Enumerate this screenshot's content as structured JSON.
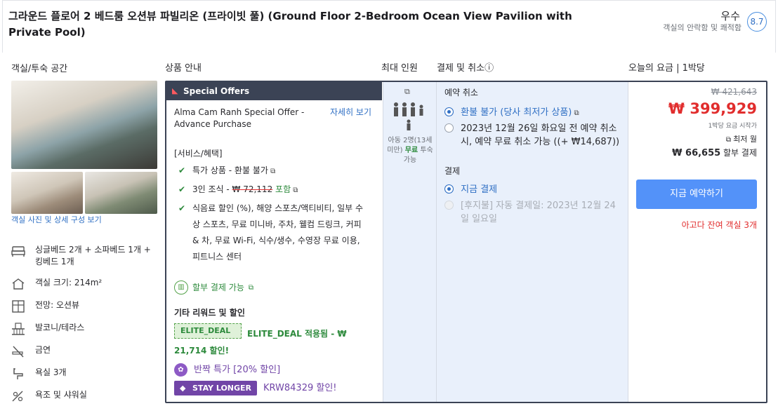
{
  "header": {
    "title": "그라운드 플로어 2 베드룸 오션뷰 파빌리온 (프라이빗 풀) (Ground Floor 2-Bedroom Ocean View Pavilion with Private Pool)",
    "rating_word": "우수",
    "rating_sub": "객실의 안락함 및 쾌적함",
    "rating_score": "8.7"
  },
  "columns": {
    "room": "객실/투숙 공간",
    "product": "상품 안내",
    "max_guests": "최대 인원",
    "payment": "결제 및 취소ⓘ",
    "price": "오늘의 요금 | 1박당"
  },
  "room": {
    "photo_link": "객실 사진 및 상세 구성 보기",
    "features": [
      {
        "icon": "bed-icon",
        "text": "싱글베드 2개 + 소파베드 1개 + 킹베드 1개"
      },
      {
        "icon": "house-icon",
        "text": "객실 크기: 214m²"
      },
      {
        "icon": "window-icon",
        "text": "전망: 오션뷰"
      },
      {
        "icon": "balcony-icon",
        "text": "발코니/테라스"
      },
      {
        "icon": "no-smoking-icon",
        "text": "금연"
      },
      {
        "icon": "bathtub-icon",
        "text": "욕실 3개"
      },
      {
        "icon": "shower-icon",
        "text": "욕조 및 샤워실"
      }
    ]
  },
  "offer": {
    "banner": "Special Offers",
    "name": "Alma Cam Ranh Special Offer - Advance Purchase",
    "details_link": "자세히 보기",
    "benefits_title": "[서비스/혜택]",
    "benefit1": "특가 상품 - 환불 불가",
    "benefit2_prefix": "3인 조식 - ",
    "benefit2_strike": "₩ 72,112",
    "benefit2_suffix": "포함",
    "benefit3": "식음료 할인 (%), 해양 스포츠/액티비티, 일부 수상 스포츠, 무료 미니바, 주차, 웰컴 드링크, 커피 & 차, 무료 Wi-Fi, 식수/생수, 수영장 무료 이용, 피트니스 센터",
    "installment": "할부 결제 가능",
    "other_title": "기타 리워드 및 할인",
    "elite_tag": "ELITE_DEAL",
    "elite_text": "ELITE_DEAL 적용됨 - ₩ 21,714 할인!",
    "flash": "반짝 특가 [20% 할인]",
    "stay_badge": "STAY LONGER",
    "stay_text": "KRW84329 할인!"
  },
  "occupancy": {
    "child_note": "아동 2명(13세 미만)",
    "free_label": "무료",
    "stay_note": "투숙 가능"
  },
  "payment": {
    "cancel_title": "예약 취소",
    "option1": "환불 불가 (당사 최저가 상품)",
    "option2": "2023년 12월 26일 화요일 전 예약 취소 시, 예약 무료 취소 가능 ((+ ₩14,687))",
    "pay_title": "결제",
    "pay1": "지금 결제",
    "pay2": "[후지불] 자동 결제일: 2023년 12월 24일 일요일"
  },
  "price": {
    "original": "₩ 421,643",
    "current": "₩ 399,929",
    "per_night": "1박당 요금 시작가",
    "lowest": "최저 월",
    "monthly_value": "₩ 66,655",
    "monthly_suffix": "할부 결제",
    "book_button": "지금 예약하기",
    "rooms_left": "아고다 잔여 객실 3개"
  }
}
